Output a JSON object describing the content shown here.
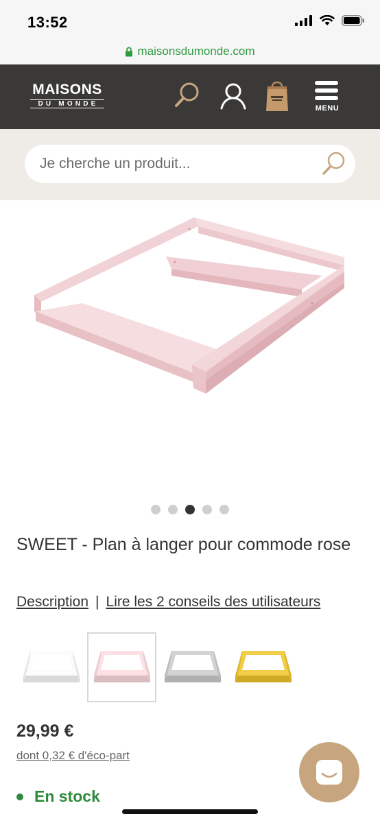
{
  "status_bar": {
    "time": "13:52"
  },
  "browser": {
    "url": "maisonsdumonde.com"
  },
  "header": {
    "logo_top": "MAISONS",
    "logo_bottom": "DU MONDE",
    "menu_label": "MENU"
  },
  "search": {
    "placeholder": "Je cherche un produit..."
  },
  "carousel": {
    "count": 5,
    "active_index": 2
  },
  "product": {
    "title": "SWEET - Plan à langer pour commode rose",
    "description_link": "Description",
    "separator": "|",
    "reviews_link": "Lire les 2 conseils des utilisateurs",
    "variants": [
      {
        "color": "#f2f2f2",
        "selected": false
      },
      {
        "color": "#f3d6da",
        "selected": true
      },
      {
        "color": "#c9c9c9",
        "selected": false
      },
      {
        "color": "#e8c33e",
        "selected": false
      }
    ],
    "price": "29,99 €",
    "eco_part": "dont 0,32 € d'éco-part",
    "stock": "En stock"
  },
  "colors": {
    "header_bg": "#3a3937",
    "accent_gold": "#c7a67f",
    "stock_green": "#2e8b3c",
    "url_green": "#2e9b3f",
    "product_pink": "#f3d6da"
  }
}
